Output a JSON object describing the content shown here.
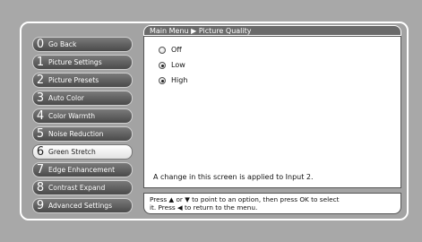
{
  "breadcrumb": "Main Menu ▶ Picture Quality",
  "menu": [
    {
      "num": "0",
      "label": "Go Back"
    },
    {
      "num": "1",
      "label": "Picture Settings"
    },
    {
      "num": "2",
      "label": "Picture Presets"
    },
    {
      "num": "3",
      "label": "Auto Color"
    },
    {
      "num": "4",
      "label": "Color Warmth"
    },
    {
      "num": "5",
      "label": "Noise Reduction"
    },
    {
      "num": "6",
      "label": "Green Stretch",
      "active": true
    },
    {
      "num": "7",
      "label": "Edge Enhancement"
    },
    {
      "num": "8",
      "label": "Contrast Expand"
    },
    {
      "num": "9",
      "label": "Advanced Settings"
    }
  ],
  "options": [
    {
      "label": "Off",
      "selected": false
    },
    {
      "label": "Low",
      "selected": true
    },
    {
      "label": "High",
      "selected": true
    }
  ],
  "note": "A change in this screen is applied to Input 2.",
  "help": {
    "line1": "Press ▲ or ▼ to point to an option, then press OK to select",
    "line2": "it. Press ◀ to return to the menu."
  }
}
